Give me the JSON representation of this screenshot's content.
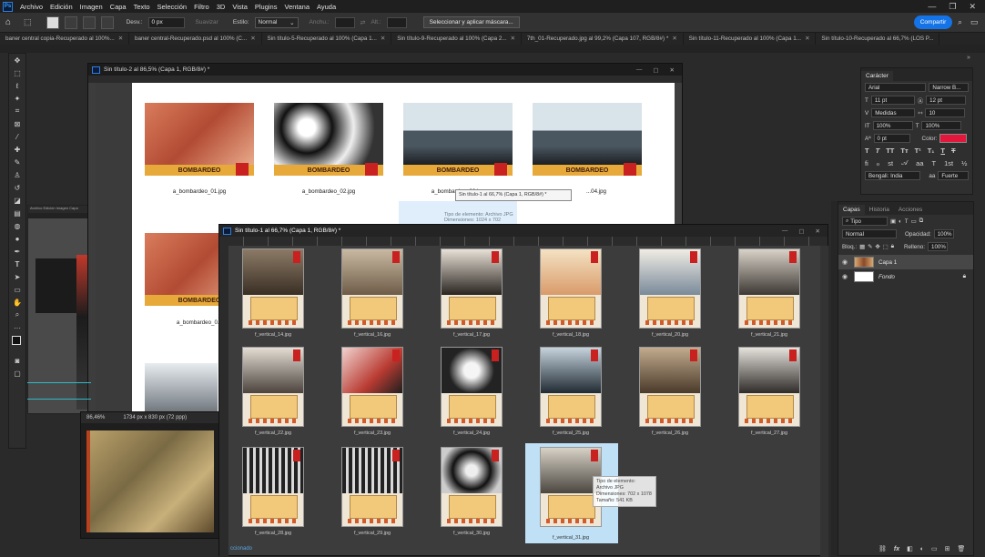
{
  "menubar": {
    "logo": "Ps",
    "items": [
      "Archivo",
      "Edición",
      "Imagen",
      "Capa",
      "Texto",
      "Selección",
      "Filtro",
      "3D",
      "Vista",
      "Plugins",
      "Ventana",
      "Ayuda"
    ]
  },
  "options": {
    "desv_label": "Desv.:",
    "desv_value": "0 px",
    "suavizar": "Suavizar",
    "estilo_label": "Estilo:",
    "estilo_value": "Normal",
    "ancho_label": "Anchu.:",
    "alto_label": "Alt.:",
    "select_mask": "Seleccionar y aplicar máscara...",
    "share": "Compartir"
  },
  "doc_tabs": [
    "baner central copia-Recuperado al 100%...",
    "baner central-Recuperado.psd al 100% (C...",
    "Sin título-5-Recuperado al 100% (Capa 1...",
    "Sin título-9-Recuperado al 100% (Capa 2...",
    "7th_01-Recuperado.jpg al 99,2% (Capa 107, RGB/8#) *",
    "Sin título-11-Recuperado al 100% (Capa 1...",
    "Sin título-10-Recuperado al 66,7% (LOS P..."
  ],
  "doc_back": {
    "title": "Sin título-2 al 86,5% (Capa 1, RGB/8#) *",
    "word": "BOMBARDEO",
    "thumbs": [
      "a_bombardeo_01.jpg",
      "a_bombardeo_02.jpg",
      "a_bombardeo_03.jpg",
      "...04.jpg",
      "a_bombardeo_0..."
    ],
    "tooltip_title": "Sin título-1 al 66,7% (Capa 1, RGB/8#) *",
    "tooltip_line1": "Tipo de elemento: Archivo JPG",
    "tooltip_line2": "Dimensiones: 1024 x 702"
  },
  "doc_front": {
    "title": "Sin título-1 al 66,7% (Capa 1, RGB/8#) *",
    "status": "ccionado",
    "rows": [
      [
        "f_vertical_14.jpg",
        "f_vertical_16.jpg",
        "f_vertical_17.jpg",
        "f_vertical_18.jpg",
        "f_vertical_20.jpg",
        "f_vertical_21.jpg"
      ],
      [
        "f_vertical_22.jpg",
        "f_vertical_23.jpg",
        "f_vertical_24.jpg",
        "f_vertical_25.jpg",
        "f_vertical_26.jpg",
        "f_vertical_27.jpg"
      ],
      [
        "f_vertical_28.jpg",
        "f_vertical_29.jpg",
        "f_vertical_30.jpg",
        "f_vertical_31.jpg"
      ]
    ],
    "tip_line1": "Tipo de elemento: Archivo JPG",
    "tip_line2": "Dimensiones: 702 x 1078",
    "tip_line3": "Tamaño: 541 KB"
  },
  "small_doc": {
    "zoom": "86,46%",
    "size": "1734 px x 830 px (72 ppp)"
  },
  "character": {
    "title": "Carácter",
    "font": "Arial",
    "font2": "Narrow B...",
    "size": "11 pt",
    "leading": "12 pt",
    "kerning": "Medidas",
    "tracking": "10",
    "vscale": "100%",
    "hscale": "100%",
    "baseline": "0 pt",
    "color_label": "Color:",
    "color_value": "#e5163c",
    "lang": "Bengali: India",
    "aa": "Fuerte"
  },
  "layers": {
    "tabs": [
      "Capas",
      "Historia",
      "Acciones"
    ],
    "filter": "Tipo",
    "blend": "Normal",
    "opacity_label": "Opacidad:",
    "opacity": "100%",
    "lock_label": "Bloq.:",
    "fill_label": "Relleno:",
    "fill": "100%",
    "items": [
      "Capa 1",
      "Fondo"
    ],
    "footer": [
      "fx"
    ]
  }
}
